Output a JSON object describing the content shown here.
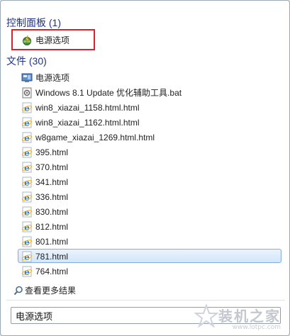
{
  "control_panel": {
    "header": "控制面板 (1)",
    "items": [
      {
        "label": "电源选项",
        "icon": "power-options-icon"
      }
    ]
  },
  "files": {
    "header": "文件 (30)",
    "items": [
      {
        "label": "电源选项",
        "icon": "control-panel-icon"
      },
      {
        "label": "Windows 8.1 Update 优化辅助工具.bat",
        "icon": "batch-file-icon"
      },
      {
        "label": "win8_xiazai_1158.html.html",
        "icon": "ie-html-icon"
      },
      {
        "label": "win8_xiazai_1162.html.html",
        "icon": "ie-html-icon"
      },
      {
        "label": "w8game_xiazai_1269.html.html",
        "icon": "ie-html-icon"
      },
      {
        "label": "395.html",
        "icon": "ie-html-icon"
      },
      {
        "label": "370.html",
        "icon": "ie-html-icon"
      },
      {
        "label": "341.html",
        "icon": "ie-html-icon"
      },
      {
        "label": "336.html",
        "icon": "ie-html-icon"
      },
      {
        "label": "830.html",
        "icon": "ie-html-icon"
      },
      {
        "label": "812.html",
        "icon": "ie-html-icon"
      },
      {
        "label": "801.html",
        "icon": "ie-html-icon"
      },
      {
        "label": "781.html",
        "icon": "ie-html-icon",
        "selected": true
      },
      {
        "label": "764.html",
        "icon": "ie-html-icon"
      }
    ]
  },
  "see_more": {
    "label": "查看更多结果",
    "icon": "search-icon"
  },
  "search": {
    "value": "电源选项"
  },
  "watermark": {
    "title": "装机之家",
    "url": "www.lotpc.com"
  },
  "colors": {
    "header": "#1e3287",
    "highlight_box": "#d8232a",
    "selected_border": "#84acdd"
  }
}
